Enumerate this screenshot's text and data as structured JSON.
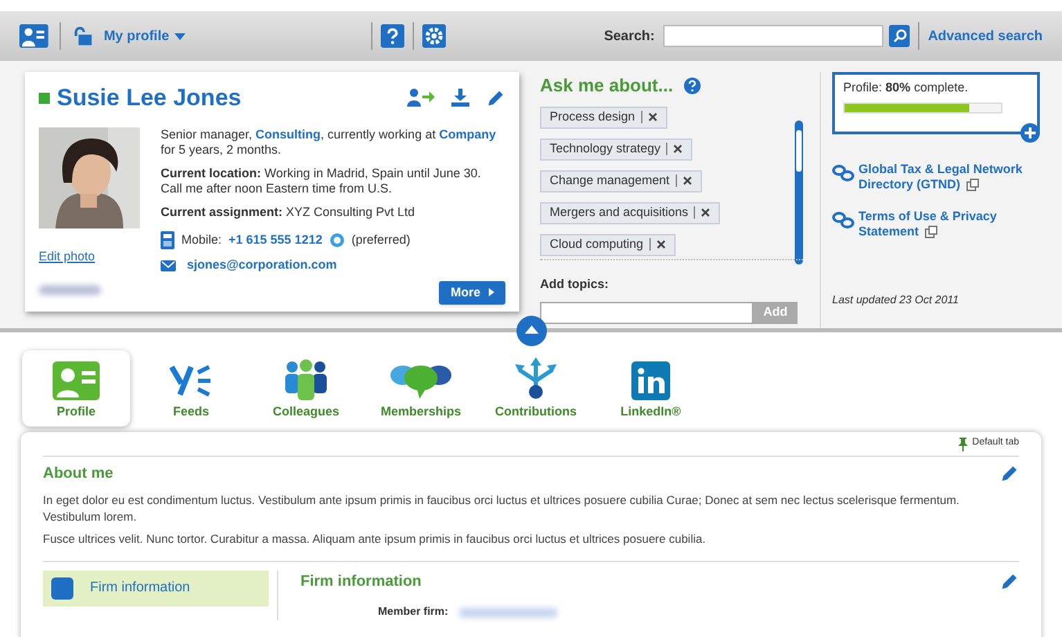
{
  "toolbar": {
    "menu_label": "My profile",
    "search_label": "Search:",
    "advanced_search": "Advanced search"
  },
  "profile": {
    "name": "Susie Lee Jones",
    "online": true,
    "summary": "Senior manager, **Consulting**, currently working at **Company** for 5 years, 2 months.",
    "location": "**Current location:** Working in Madrid, Spain until June 30. Call me after noon Eastern time from U.S.",
    "assignment": "**Current assignment:** XYZ Consulting Pvt Ltd",
    "edit_photo": "Edit photo",
    "mobile_label": "Mobile:",
    "mobile": "+1 615 555 1212",
    "preferred": "(preferred)",
    "email": "sjones@corporation.com",
    "more": "More"
  },
  "ask_me_about": {
    "title": "Ask me about...",
    "topics": [
      "Process design",
      "Technology strategy",
      "Change management",
      "Mergers and acquisitions",
      "Cloud computing"
    ],
    "add_label": "Add topics:",
    "add_button": "Add"
  },
  "completeness": {
    "prefix": "Profile:",
    "percent": "80%",
    "suffix": "complete.",
    "level": 0.8
  },
  "links": [
    "Global Tax & Legal Network Directory (GTND)",
    "Terms of Use & Privacy Statement"
  ],
  "last_updated": "Last updated 23 Oct 2011",
  "tabs": [
    {
      "label": "Profile",
      "kind": "profile",
      "selected": true
    },
    {
      "label": "Feeds",
      "kind": "feeds",
      "selected": false
    },
    {
      "label": "Colleagues",
      "kind": "colleagues",
      "selected": false
    },
    {
      "label": "Memberships",
      "kind": "memberships",
      "selected": false
    },
    {
      "label": "Contributions",
      "kind": "contributions",
      "selected": false
    },
    {
      "label": "LinkedIn®",
      "kind": "linkedin",
      "selected": false
    }
  ],
  "default_tab": "Default tab",
  "about": {
    "title": "About me",
    "paragraphs": [
      "In eget dolor eu est condimentum luctus. Vestibulum ante ipsum primis in faucibus orci luctus et ultrices posuere cubilia Curae; Donec at sem nec lectus scelerisque fermentum. Vestibulum lorem.",
      "Fusce ultrices velit. Nunc tortor. Curabitur a massa. Aliquam ante ipsum primis in faucibus orci luctus et ultrices posuere cubilia."
    ]
  },
  "side_nav": [
    {
      "label": "Firm information",
      "selected": true
    }
  ],
  "firm": {
    "title": "Firm information",
    "member_firm_label": "Member firm:"
  }
}
